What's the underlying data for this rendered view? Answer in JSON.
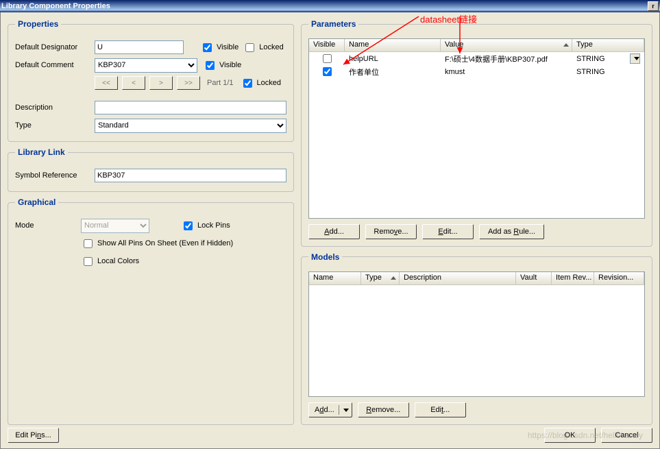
{
  "window": {
    "title": "Library Component Properties"
  },
  "annotation": {
    "text": "datasheet链接"
  },
  "properties": {
    "legend": "Properties",
    "default_designator_label": "Default Designator",
    "default_designator_value": "U",
    "default_comment_label": "Default Comment",
    "default_comment_value": "KBP307",
    "visible_label": "Visible",
    "locked_label": "Locked",
    "designator_visible": true,
    "designator_locked": false,
    "comment_visible": true,
    "part_locked": true,
    "nav": {
      "first": "<<",
      "prev": "<",
      "next": ">",
      "last": ">>"
    },
    "part_label": "Part 1/1",
    "description_label": "Description",
    "description_value": "",
    "type_label": "Type",
    "type_value": "Standard"
  },
  "library_link": {
    "legend": "Library Link",
    "symbol_reference_label": "Symbol Reference",
    "symbol_reference_value": "KBP307"
  },
  "graphical": {
    "legend": "Graphical",
    "mode_label": "Mode",
    "mode_value": "Normal",
    "lock_pins_label": "Lock Pins",
    "lock_pins": true,
    "show_all_pins_label": "Show All Pins On Sheet (Even if Hidden)",
    "show_all_pins": false,
    "local_colors_label": "Local Colors",
    "local_colors": false
  },
  "parameters": {
    "legend": "Parameters",
    "headers": {
      "visible": "Visible",
      "name": "Name",
      "value": "Value",
      "type": "Type"
    },
    "rows": [
      {
        "visible": false,
        "name": "helpURL",
        "value": "F:\\硕士\\4数据手册\\KBP307.pdf",
        "type": "STRING"
      },
      {
        "visible": true,
        "name": "作者单位",
        "value": "kmust",
        "type": "STRING"
      }
    ],
    "buttons": {
      "add": "Add...",
      "remove": "Remove...",
      "edit": "Edit...",
      "add_as_rule": "Add as Rule..."
    }
  },
  "models": {
    "legend": "Models",
    "headers": {
      "name": "Name",
      "type": "Type",
      "description": "Description",
      "vault": "Vault",
      "item_rev": "Item Rev...",
      "revision": "Revision..."
    },
    "buttons": {
      "add": "Add...",
      "remove": "Remove...",
      "edit": "Edit..."
    }
  },
  "footer": {
    "edit_pins": "Edit Pins...",
    "ok": "OK",
    "cancel": "Cancel"
  },
  "watermark": "https://blog.csdn.net/hellokandy"
}
